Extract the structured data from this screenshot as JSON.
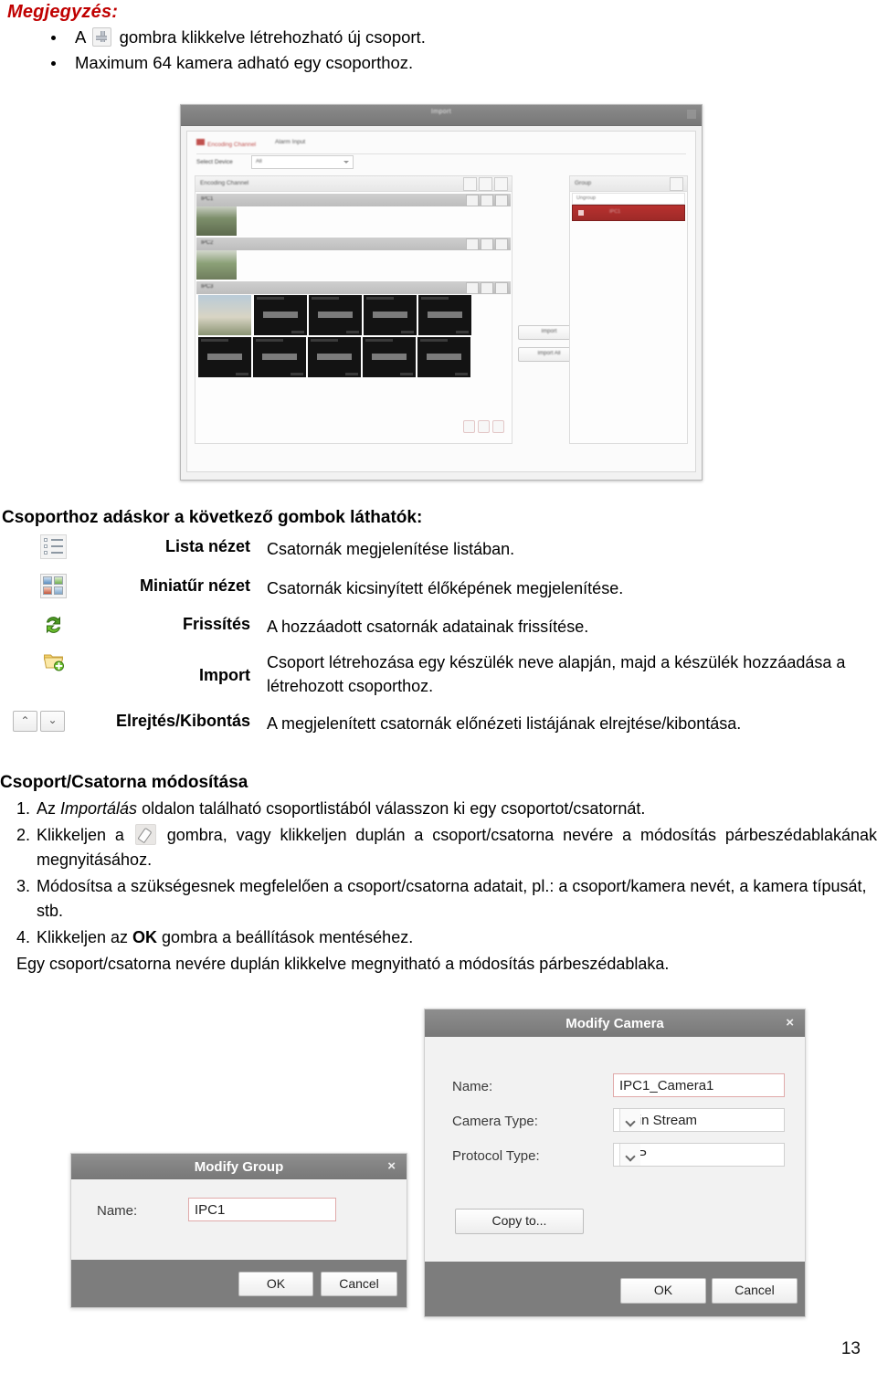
{
  "note": {
    "title": "Megjegyzés:",
    "bullets": [
      {
        "before": "A ",
        "icon": "plus-in-box-icon",
        "after": " gombra klikkelve létrehozható új csoport."
      },
      {
        "before": "Maximum 64 kamera adható egy csoporthoz.",
        "icon": null,
        "after": ""
      }
    ]
  },
  "app_screenshot": {
    "window_title": "Import",
    "tabs": [
      {
        "label": "Encoding Channel",
        "active": true
      },
      {
        "label": "Alarm Input",
        "active": false
      }
    ],
    "select_device_label": "Select Device",
    "select_device_value": "All",
    "left_panel_title": "Encoding Channel",
    "right_panel_title": "Group",
    "right_panel_item": "Ungroup",
    "right_panel_selected": "IPC1",
    "groups": [
      "IPC1",
      "IPC2",
      "IPC3"
    ],
    "mid_buttons": [
      "Import",
      "Import All"
    ]
  },
  "buttons_section": {
    "heading": "Csoporthoz adáskor a következő gombok láthatók:",
    "rows": [
      {
        "icon": "list-view-icon",
        "name": "Lista nézet",
        "desc": "Csatornák megjelenítése listában."
      },
      {
        "icon": "thumbnail-view-icon",
        "name": "Miniatűr nézet",
        "desc": "Csatornák kicsinyített élőképének megjelenítése."
      },
      {
        "icon": "refresh-icon",
        "name": "Frissítés",
        "desc": "A hozzáadott csatornák adatainak frissítése."
      },
      {
        "icon": "import-folder-icon",
        "name": "Import",
        "desc": "Csoport létrehozása egy készülék neve alapján, majd a készülék hozzáadása a létrehozott csoporthoz."
      },
      {
        "icon": "collapse-expand-icon",
        "name": "Elrejtés/Kibontás",
        "desc": "A megjelenített csatornák előnézeti listájának elrejtése/kibontása."
      }
    ]
  },
  "modify_section": {
    "heading": "Csoport/Csatorna módosítása",
    "steps": [
      {
        "num": "1.",
        "parts": [
          {
            "t": "Az ",
            "style": "normal"
          },
          {
            "t": "Importálás",
            "style": "italic"
          },
          {
            "t": " oldalon található csoportlistából válasszon ki egy csoportot/csatornát.",
            "style": "normal"
          }
        ]
      },
      {
        "num": "2.",
        "parts": [
          {
            "t": "Klikkeljen a ",
            "style": "normal"
          },
          {
            "t": "",
            "style": "icon",
            "icon": "pencil-edit-icon"
          },
          {
            "t": " gombra, vagy klikkeljen duplán a csoport/csatorna nevére a módosítás párbeszédablakának megnyitásához.",
            "style": "normal"
          }
        ]
      },
      {
        "num": "3.",
        "parts": [
          {
            "t": "Módosítsa a szükségesnek megfelelően a csoport/csatorna adatait, pl.: a csoport/kamera nevét, a kamera típusát, stb.",
            "style": "normal"
          }
        ]
      },
      {
        "num": "4.",
        "parts": [
          {
            "t": "Klikkeljen az ",
            "style": "normal"
          },
          {
            "t": "OK",
            "style": "bold"
          },
          {
            "t": " gombra a beállítások mentéséhez.",
            "style": "normal"
          }
        ]
      }
    ],
    "closing": "Egy csoport/csatorna nevére duplán klikkelve megnyitható a módosítás párbeszédablaka."
  },
  "modify_camera_dialog": {
    "title": "Modify Camera",
    "close_label": "×",
    "fields": [
      {
        "label": "Name:",
        "value": "IPC1_Camera1",
        "type": "text"
      },
      {
        "label": "Camera Type:",
        "value": "Main Stream",
        "type": "select"
      },
      {
        "label": "Protocol Type:",
        "value": "TCP",
        "type": "select"
      }
    ],
    "copy_to_label": "Copy to...",
    "ok_label": "OK",
    "cancel_label": "Cancel"
  },
  "modify_group_dialog": {
    "title": "Modify Group",
    "close_label": "×",
    "fields": [
      {
        "label": "Name:",
        "value": "IPC1",
        "type": "text"
      }
    ],
    "ok_label": "OK",
    "cancel_label": "Cancel"
  },
  "footer": {
    "page_number": "13"
  },
  "colors": {
    "note_red": "#c00000",
    "dialog_titlebar": "#7d7d7d",
    "selection_red": "#9e2a28",
    "input_border_red": "#e0aaaa"
  }
}
